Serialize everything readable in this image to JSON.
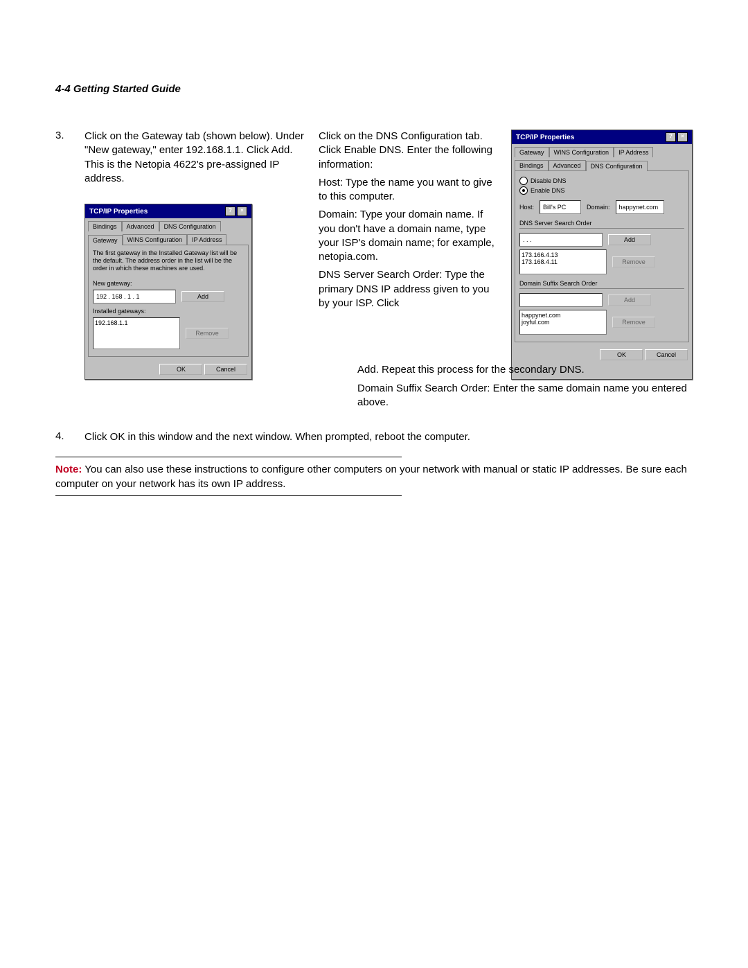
{
  "header": "4-4 Getting Started Guide",
  "steps": {
    "s3_num": "3.",
    "s3_left": "Click on the Gateway tab (shown below). Under \"New gateway,\" enter 192.168.1.1. Click Add. This is the Netopia 4622's pre-assigned IP address.",
    "s3_right_intro": "Click on the DNS Configuration tab. Click Enable DNS. Enter the following information:",
    "s3_host": "Host: Type the name you want to give to this computer.",
    "s3_domain": "Domain: Type your domain name. If you don't have a domain name, type your ISP's domain name; for example, netopia.com.",
    "s3_dns_part1": "DNS Server Search Order: Type the primary DNS IP address given to you by your ISP. Click",
    "s3_dns_part2": "Add. Repeat this process for the secondary DNS.",
    "s3_suffix": "Domain Suffix Search Order: Enter the same domain name you entered above.",
    "s4_num": "4.",
    "s4_text": "Click OK in this window and the next window. When prompted, reboot the computer."
  },
  "note": {
    "label": "Note:",
    "text": "You can also use these instructions to configure other computers on your network with manual or static IP addresses. Be sure each computer on your network has its own IP address."
  },
  "dlg1": {
    "title": "TCP/IP Properties",
    "tabs_row1": [
      "Bindings",
      "Advanced",
      "DNS Configuration"
    ],
    "tabs_row2": [
      "Gateway",
      "WINS Configuration",
      "IP Address"
    ],
    "desc": "The first gateway in the Installed Gateway list will be the default. The address order in the list will be the order in which these machines are used.",
    "new_gw_label": "New gateway:",
    "new_gw_value": "192 . 168 .  1  .  1",
    "add_btn": "Add",
    "installed_label": "Installed gateways:",
    "installed_item": "192.168.1.1",
    "remove_btn": "Remove",
    "ok": "OK",
    "cancel": "Cancel"
  },
  "dlg2": {
    "title": "TCP/IP Properties",
    "tabs_row1": [
      "Gateway",
      "WINS Configuration",
      "IP Address"
    ],
    "tabs_row2": [
      "Bindings",
      "Advanced",
      "DNS Configuration"
    ],
    "disable": "Disable DNS",
    "enable": "Enable DNS",
    "host_label": "Host:",
    "host_value": "Bill's PC",
    "domain_label": "Domain:",
    "domain_value": "happynet.com",
    "dns_order_label": "DNS Server Search Order",
    "dns_entry": "  .   .   .  ",
    "add_btn": "Add",
    "remove_btn": "Remove",
    "dns_list": [
      "173.166.4.13",
      "173.168.4.11"
    ],
    "suffix_label": "Domain Suffix Search Order",
    "suffix_entry": "",
    "suffix_list": [
      "happynet.com",
      "joyful.com"
    ],
    "ok": "OK",
    "cancel": "Cancel"
  }
}
